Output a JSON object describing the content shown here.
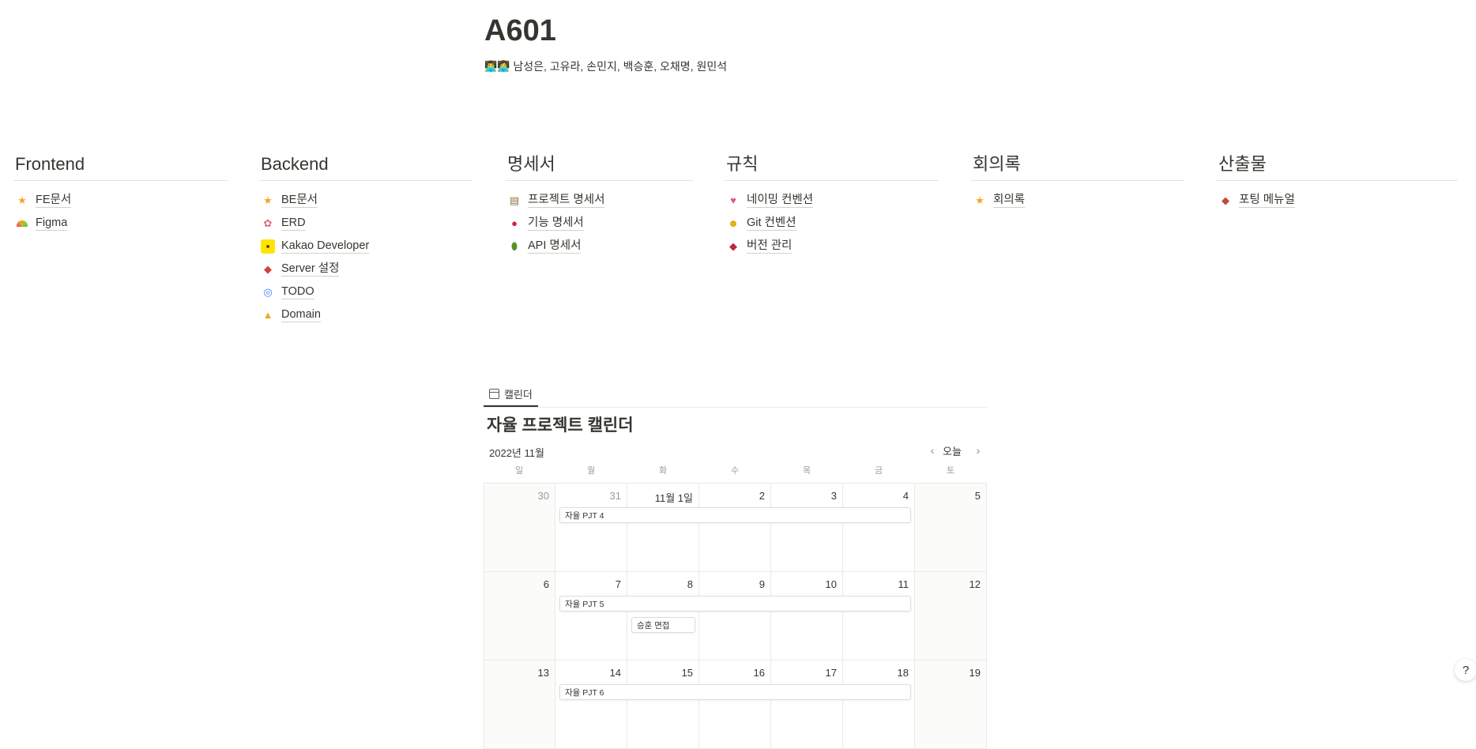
{
  "page": {
    "title": "A601",
    "members_icons": "👨‍💻👩‍💻",
    "members": "남성은, 고유라, 손민지, 백승훈, 오채명, 원민석"
  },
  "columns": [
    {
      "heading": "Frontend",
      "items": [
        {
          "icon": "star-icon",
          "label": "FE문서"
        },
        {
          "icon": "rainbow-icon",
          "label": "Figma"
        }
      ]
    },
    {
      "heading": "Backend",
      "items": [
        {
          "icon": "star-icon",
          "label": "BE문서"
        },
        {
          "icon": "flower-icon",
          "label": "ERD"
        },
        {
          "icon": "kakao-icon",
          "label": "Kakao Developer"
        },
        {
          "icon": "car-icon",
          "label": "Server 설정"
        },
        {
          "icon": "cyclone-icon",
          "label": "TODO"
        },
        {
          "icon": "bell-icon",
          "label": "Domain"
        }
      ]
    },
    {
      "heading": "명세서",
      "items": [
        {
          "icon": "clipboard-icon",
          "label": "프로젝트 명세서"
        },
        {
          "icon": "apple-icon",
          "label": "기능 명세서"
        },
        {
          "icon": "avocado-icon",
          "label": "API 명세서"
        }
      ]
    },
    {
      "heading": "규칙",
      "items": [
        {
          "icon": "heart-icon",
          "label": "네이밍 컨벤션"
        },
        {
          "icon": "grin-icon",
          "label": "Git 컨벤션"
        },
        {
          "icon": "ticket-icon",
          "label": "버전 관리"
        }
      ]
    },
    {
      "heading": "회의록",
      "items": [
        {
          "icon": "star-icon",
          "label": "회의록"
        }
      ]
    },
    {
      "heading": "산출물",
      "items": [
        {
          "icon": "candy-icon",
          "label": "포팅 메뉴얼"
        }
      ]
    }
  ],
  "calendar": {
    "tab_label": "캘린더",
    "title": "자율 프로젝트 캘린더",
    "month": "2022년 11월",
    "today_label": "오늘",
    "weekdays": [
      "일",
      "월",
      "화",
      "수",
      "목",
      "금",
      "토"
    ],
    "weeks": [
      [
        "30",
        "31",
        "11월 1일",
        "2",
        "3",
        "4",
        "5"
      ],
      [
        "6",
        "7",
        "8",
        "9",
        "10",
        "11",
        "12"
      ],
      [
        "13",
        "14",
        "15",
        "16",
        "17",
        "18",
        "19"
      ]
    ],
    "events": [
      {
        "title": "자율 PJT 4"
      },
      {
        "title": "자율 PJT 5"
      },
      {
        "title": "승훈 면접"
      },
      {
        "title": "자율 PJT 6"
      }
    ]
  },
  "help_label": "?"
}
